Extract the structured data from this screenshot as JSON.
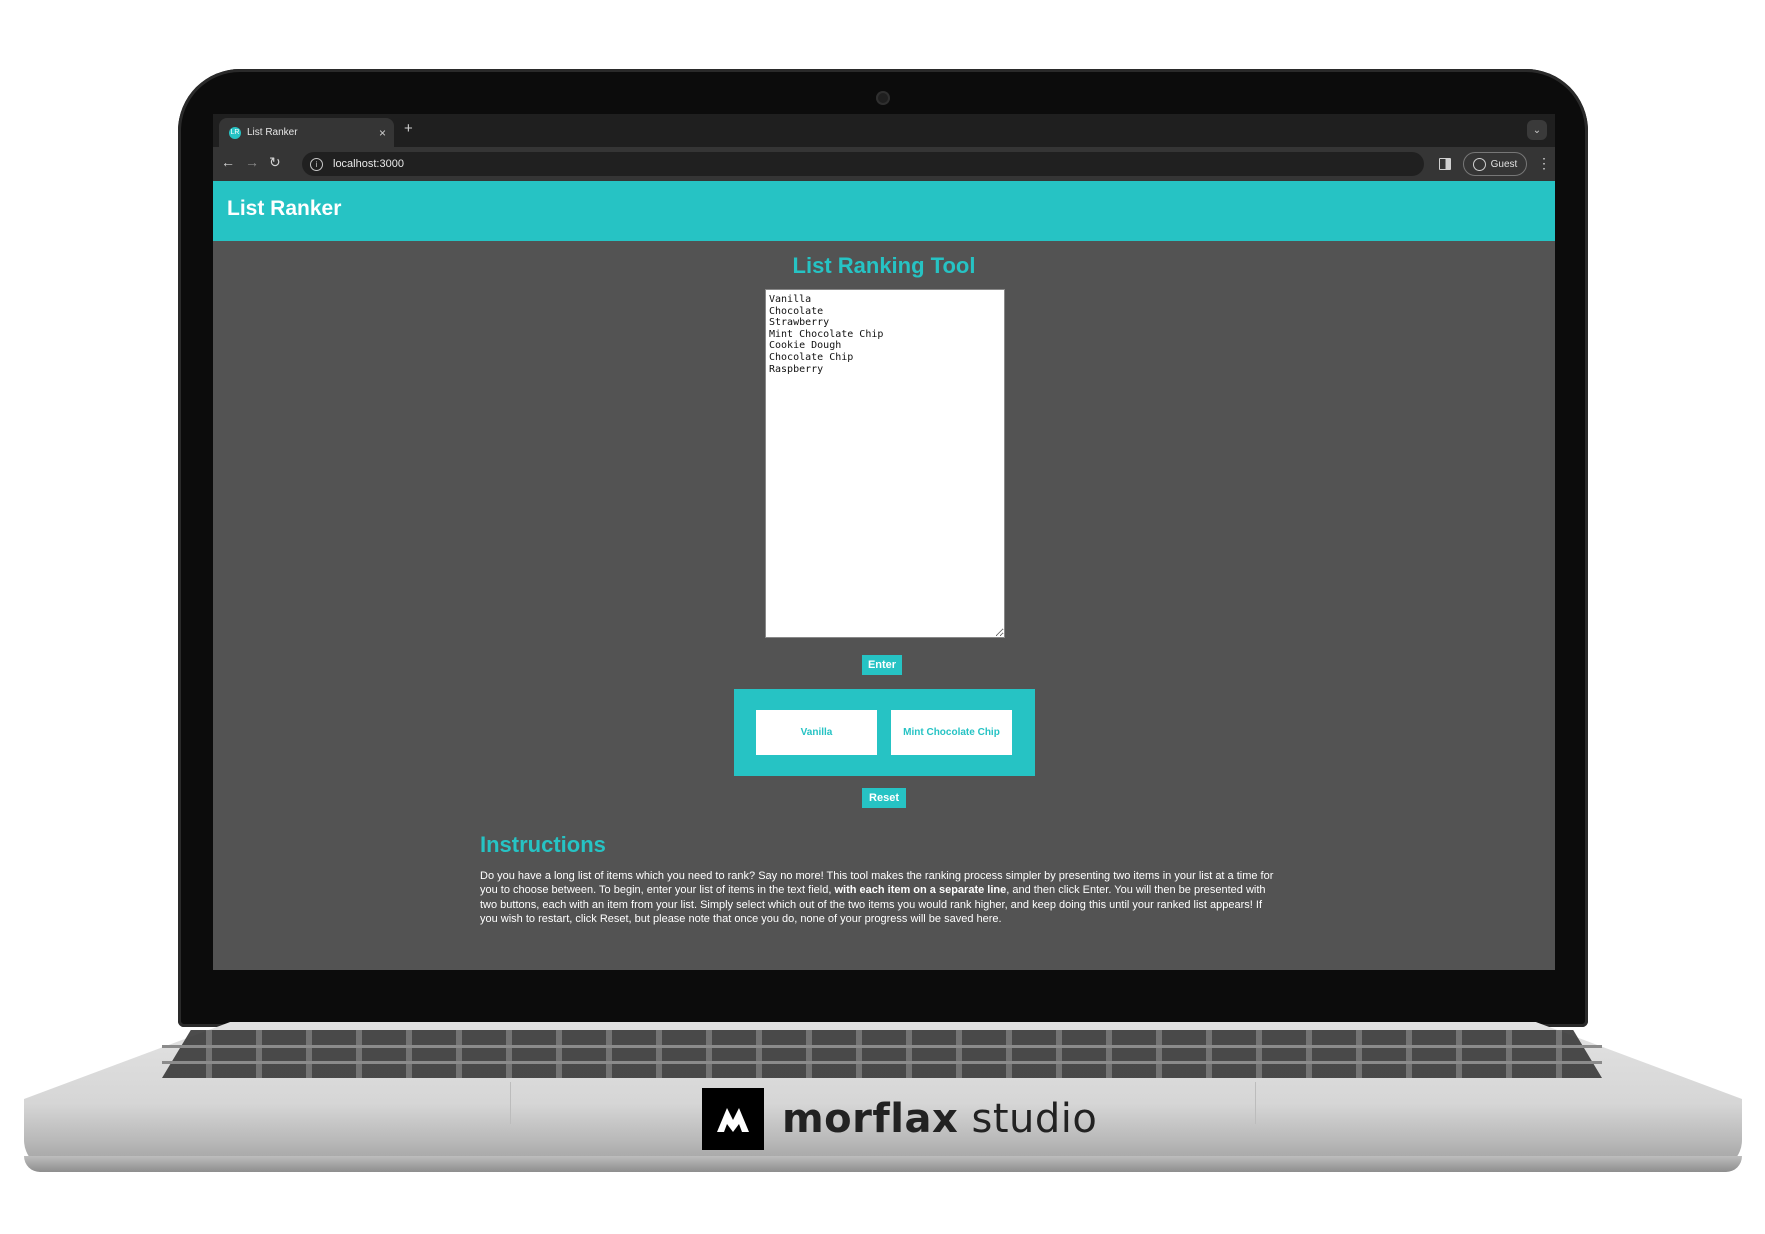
{
  "browser": {
    "tab_title": "List Ranker",
    "tab_favicon_text": "LR",
    "tab_close": "×",
    "new_tab": "+",
    "url": "localhost:3000",
    "profile_label": "Guest"
  },
  "app": {
    "brand_title": "List Ranker",
    "page_title": "List Ranking Tool",
    "list_text": "Vanilla\nChocolate\nStrawberry\nMint Chocolate Chip\nCookie Dough\nChocolate Chip\nRaspberry",
    "enter_label": "Enter",
    "choice_left": "Vanilla",
    "choice_right": "Mint Chocolate Chip",
    "reset_label": "Reset"
  },
  "instructions": {
    "heading": "Instructions",
    "text_before_bold": "Do you have a long list of items which you need to rank? Say no more! This tool makes the ranking process simpler by presenting two items in your list at a time for you to choose between. To begin, enter your list of items in the text field, ",
    "text_bold": "with each item on a separate line",
    "text_after_bold": ", and then click Enter. You will then be presented with two buttons, each with an item from your list. Simply select which out of the two items you would rank higher, and keep doing this until your ranked list appears! If you wish to restart, click Reset, but please note that once you do, none of your progress will be saved here."
  },
  "watermark": {
    "brand_bold": "morflax",
    "brand_light": " studio"
  },
  "colors": {
    "accent": "#26c3c4",
    "page_background": "#535353",
    "browser_chrome": "#353535"
  },
  "icons": [
    "back-arrow-icon",
    "forward-arrow-icon",
    "reload-icon",
    "site-info-icon",
    "side-panel-icon",
    "profile-icon",
    "more-menu-icon",
    "tab-search-icon"
  ]
}
